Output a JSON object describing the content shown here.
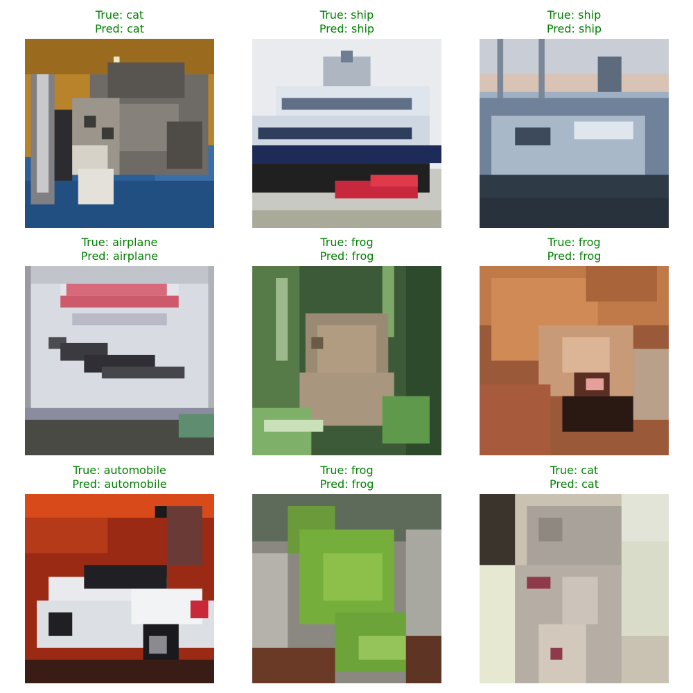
{
  "colors": {
    "correct_label": "#008000"
  },
  "grid": [
    {
      "true_label": "True: cat",
      "pred_label": "Pred: cat",
      "subject": "cat-on-blue-blanket"
    },
    {
      "true_label": "True: ship",
      "pred_label": "Pred: ship",
      "subject": "ship-white-red-hull"
    },
    {
      "true_label": "True: ship",
      "pred_label": "Pred: ship",
      "subject": "boat-in-harbor"
    },
    {
      "true_label": "True: airplane",
      "pred_label": "Pred: airplane",
      "subject": "concorde-poster"
    },
    {
      "true_label": "True: frog",
      "pred_label": "Pred: frog",
      "subject": "frog-in-grass"
    },
    {
      "true_label": "True: frog",
      "pred_label": "Pred: frog",
      "subject": "orange-frog"
    },
    {
      "true_label": "True: automobile",
      "pred_label": "Pred: automobile",
      "subject": "white-car-red-background"
    },
    {
      "true_label": "True: frog",
      "pred_label": "Pred: frog",
      "subject": "green-frog"
    },
    {
      "true_label": "True: cat",
      "pred_label": "Pred: cat",
      "subject": "light-grey-cat"
    }
  ]
}
